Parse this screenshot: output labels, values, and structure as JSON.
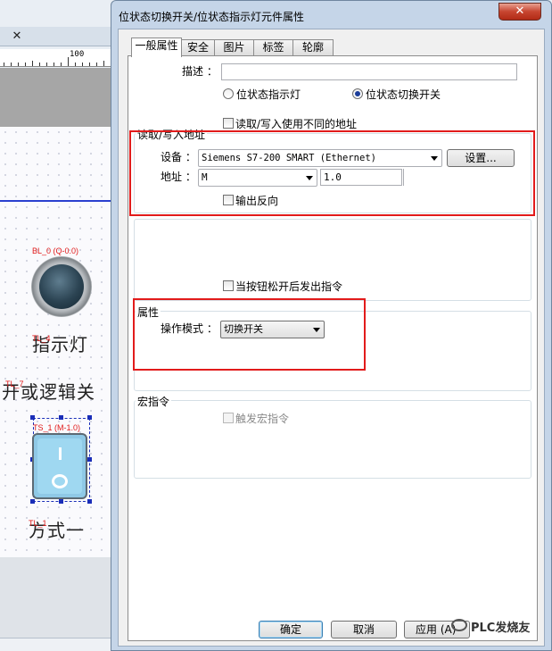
{
  "editor": {
    "ruler_label": "100",
    "lamp_tag": "BL_0 (Q-0.0)",
    "lamp_title": "指示灯",
    "lamp_title_tag": "TL_4",
    "switch_caption": "开或逻辑关",
    "switch_caption_tag": "TL_7",
    "switch_tag": "TS_1 (M-1.0)",
    "mode_caption": "方式一",
    "mode_caption_tag": "TL_1"
  },
  "dialog": {
    "title": "位状态切换开关/位状态指示灯元件属性",
    "close_glyph": "✕",
    "tabs": [
      "一般属性",
      "安全",
      "图片",
      "标签",
      "轮廓"
    ],
    "active_tab": 0,
    "description_label": "描述 ：",
    "description_value": "",
    "radio_indicator": "位状态指示灯",
    "radio_switch": "位状态切换开关",
    "selected_radio": "位状态切换开关",
    "diff_address_label": "读取/写入使用不同的地址",
    "rw_group": {
      "title": "读取/写入地址",
      "device_label": "设备 ：",
      "device_value": "Siemens S7-200 SMART (Ethernet)",
      "settings_button": "设置...",
      "address_label": "地址 ：",
      "address_type": "M",
      "address_value": "1.0",
      "invert_output_label": "输出反向"
    },
    "release_label": "当按钮松开后发出指令",
    "attr_group": {
      "title": "属性",
      "mode_label": "操作模式 ：",
      "mode_value": "切换开关"
    },
    "macro_group": {
      "title": "宏指令",
      "trigger_label": "触发宏指令"
    },
    "buttons": {
      "ok": "确定",
      "cancel": "取消",
      "apply": "应用 (A)"
    }
  },
  "watermark": "PLC发烧友",
  "colors": {
    "highlight": "#e21b1b",
    "selection": "#1a2eb8",
    "radio_dot": "#1b3d9a"
  }
}
